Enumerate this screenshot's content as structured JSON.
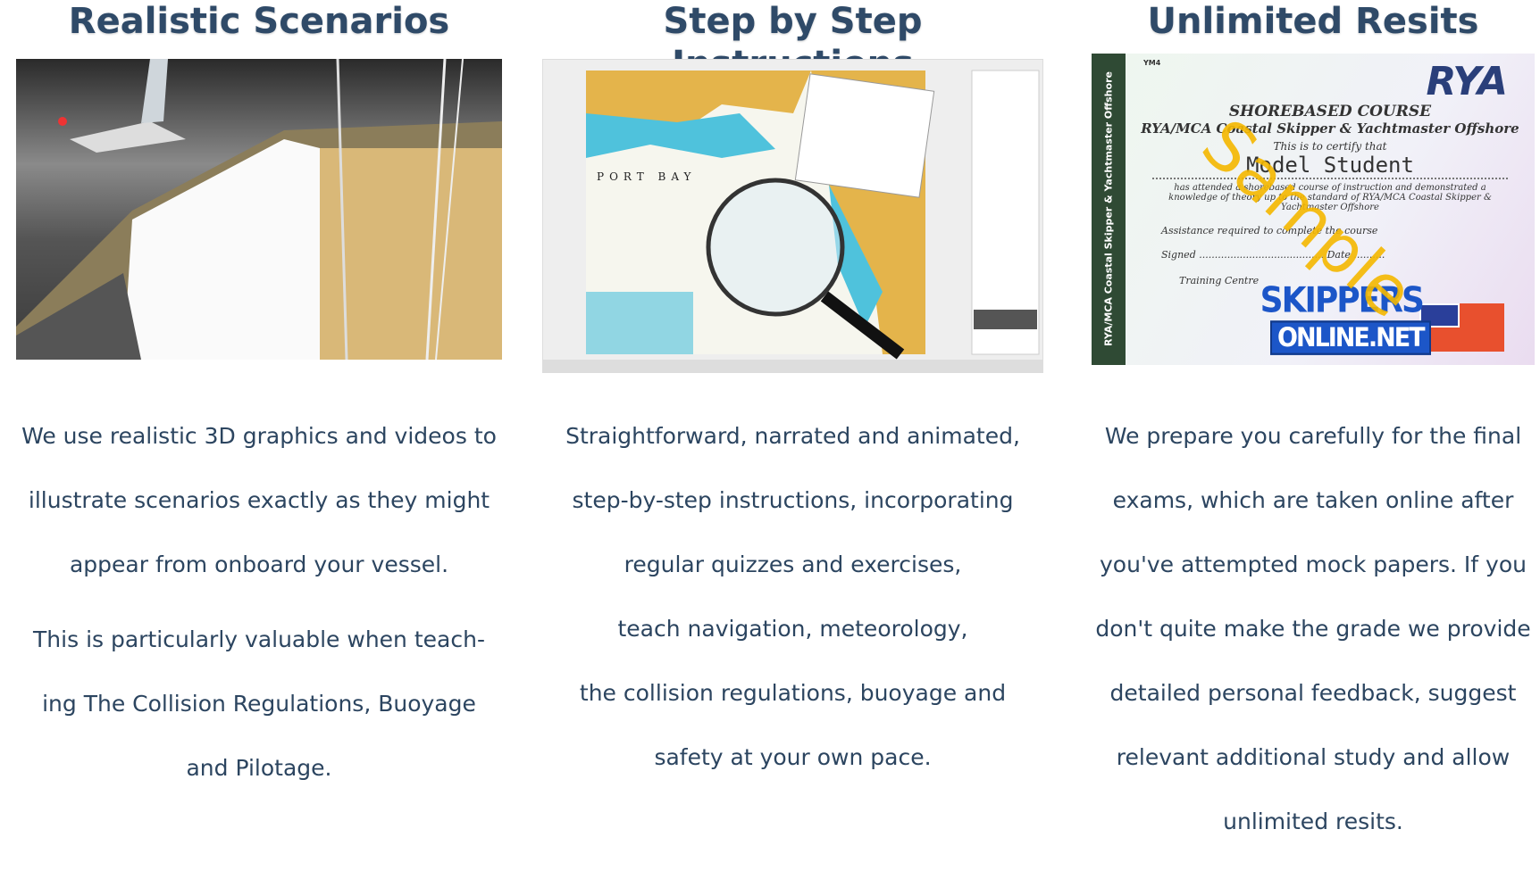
{
  "columns": [
    {
      "title": "Realistic Scenarios",
      "image": "3d-yacht-scene",
      "paragraphs": [
        [
          "We use realistic 3D graphics and videos to",
          "illustrate scenarios exactly as they might",
          "appear from onboard your vessel."
        ],
        [
          "This is particularly valuable when teach-",
          "ing The Collision Regulations, Buoyage",
          "and Pilotage."
        ]
      ]
    },
    {
      "title": "Step by Step Instructions",
      "image": "chart-navigation-lesson",
      "chart_text": "PORT BAY",
      "paragraphs": [
        [
          "Straightforward, narrated and animated,",
          "step-by-step instructions, incorporating",
          "regular quizzes and exercises,",
          "teach navigation, meteorology,",
          "the collision regulations, buoyage and",
          "safety at your own pace."
        ]
      ]
    },
    {
      "title": "Unlimited Resits",
      "image": "sample-certificate",
      "certificate": {
        "code": "YM4",
        "logo": "RYA",
        "heading": "SHOREBASED COURSE",
        "course": "RYA/MCA Coastal Skipper & Yachtmaster Offshore",
        "certify": "This is to certify that",
        "name": "Model Student",
        "attended": "has attended a shorebased course of instruction and demonstrated a knowledge of theory up to the standard of RYA/MCA Coastal Skipper & Yachtmaster Offshore",
        "assistance": "Assistance required to complete the course",
        "signed": "Signed",
        "date": "Date",
        "centre": "Training Centre",
        "spine": "RYA/MCA Coastal Skipper & Yachtmaster Offshore",
        "watermark": "Sample",
        "brand_top": "SKIPPERS",
        "brand_bottom": "ONLINE.NET"
      },
      "paragraphs": [
        [
          "We prepare you carefully for the final",
          "exams, which are taken online after",
          "you've attempted mock papers. If you",
          "don't quite make the grade we provide",
          "detailed personal feedback,  suggest",
          "relevant additional study and allow",
          "unlimited resits."
        ]
      ]
    }
  ],
  "colors": {
    "title": "#2f4a68",
    "text": "#2c4560",
    "watermark": "#f5b800",
    "brand": "#1c56c8"
  }
}
